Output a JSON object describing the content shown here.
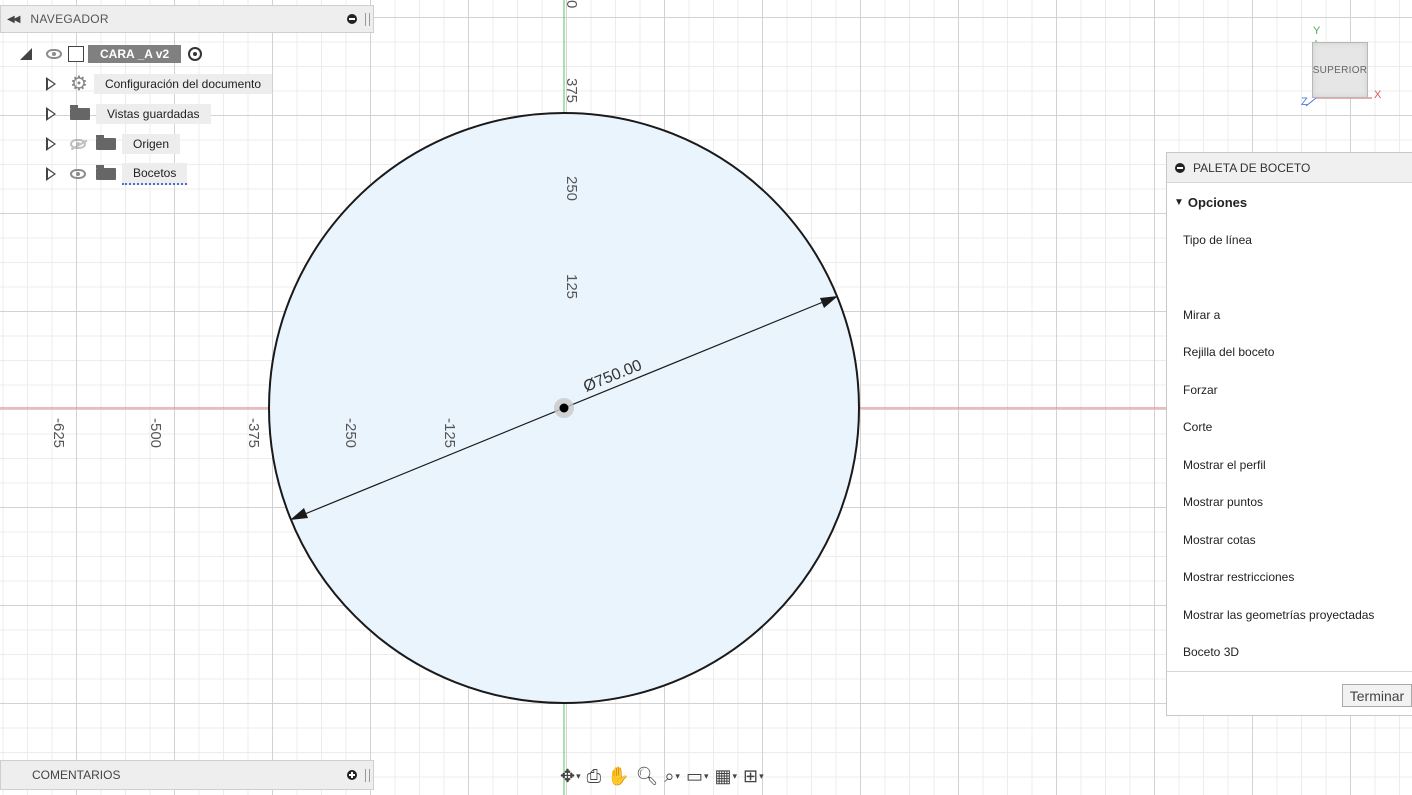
{
  "navigator": {
    "title": "NAVEGADOR",
    "root": {
      "label": "CARA _A v2"
    },
    "items": [
      {
        "label": "Configuración del documento",
        "icon": "gear-icon"
      },
      {
        "label": "Vistas guardadas",
        "icon": "folder-icon"
      },
      {
        "label": "Origen",
        "icon": "folder-icon",
        "visibility": "hidden"
      },
      {
        "label": "Bocetos",
        "icon": "folder-icon",
        "visibility": "visible"
      }
    ]
  },
  "comments": {
    "title": "COMENTARIOS"
  },
  "viewcube": {
    "face": "SUPERIOR",
    "axis_x": "X",
    "axis_y": "Y",
    "axis_z": "Z"
  },
  "canvas": {
    "x_ticks": [
      "-625",
      "-500",
      "-375",
      "-250",
      "-125"
    ],
    "y_ticks": [
      "0",
      "375",
      "250",
      "125"
    ],
    "dimension": "Ø750.00",
    "circle_fill": "#eaf4fc",
    "x_axis_color": "#e07070",
    "y_axis_color": "#58c058"
  },
  "palette": {
    "title": "PALETA DE BOCETO",
    "section": "Opciones",
    "options": [
      "Tipo de línea",
      "Mirar a",
      "Rejilla del boceto",
      "Forzar",
      "Corte",
      "Mostrar el perfil",
      "Mostrar puntos",
      "Mostrar cotas",
      "Mostrar restricciones",
      "Mostrar las geometrías proyectadas",
      "Boceto 3D"
    ],
    "finish_label": "Terminar"
  },
  "toolbar": {
    "tools": [
      "orbit-icon",
      "look-at-icon",
      "pan-icon",
      "zoom-icon",
      "fit-icon",
      "display-settings-icon",
      "grid-icon",
      "viewports-icon"
    ]
  }
}
